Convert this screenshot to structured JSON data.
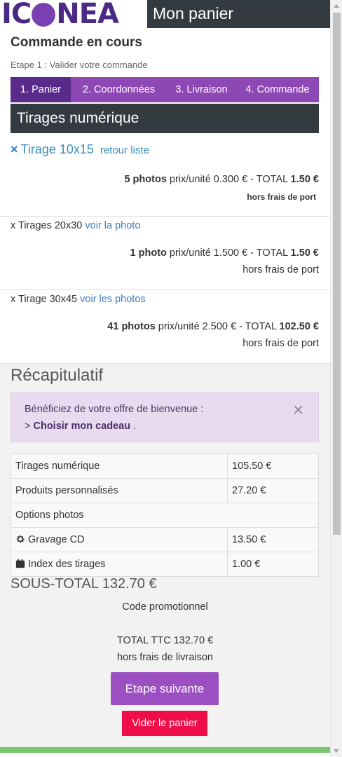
{
  "header": {
    "logo_text_left": "IC",
    "logo_text_right": "NEA",
    "title": "Mon panier"
  },
  "order": {
    "heading": "Commande en cours",
    "step_text": "Etape 1 : Valider votre commande",
    "steps": [
      "1. Panier",
      "2. Coordonnées",
      "3. Livraison",
      "4. Commande"
    ]
  },
  "section": {
    "title": "Tirages numérique"
  },
  "items": [
    {
      "close_icon": "×",
      "name": "Tirage 10x15",
      "link": "retour liste",
      "qty": "5 photos",
      "unit_label": " prix/unité 0.300 € - TOTAL ",
      "total": "1.50 €",
      "note": "hors frais de port"
    },
    {
      "prefix": "x Tirages 20x30 ",
      "link": "voir la photo",
      "qty": "1 photo",
      "unit_label": " prix/unité 1.500 € - TOTAL ",
      "total": "1.50 €",
      "note": "hors frais de port"
    },
    {
      "prefix": "x Tirage 30x45 ",
      "link": "voir les photos",
      "qty": "41 photos",
      "unit_label": " prix/unité 2.500 € - TOTAL ",
      "total": "102.50 €",
      "note": "hors frais de port"
    }
  ],
  "recap": {
    "title": "Récapitulatif",
    "alert_line1": "Bénéficiez de votre offre de bienvenue :",
    "alert_prefix": "> ",
    "alert_link": "Choisir mon cadeau",
    "alert_suffix": " .",
    "alert_close": "×",
    "rows": [
      {
        "label": "Tirages numérique",
        "value": "105.50 €"
      },
      {
        "label": "Produits personnalisés",
        "value": "27.20 €"
      },
      {
        "label": "Options photos"
      },
      {
        "icon": "gear-icon",
        "label": "Gravage CD",
        "value": "13.50 €"
      },
      {
        "icon": "calendar-icon",
        "label": "Index des tirages",
        "value": "1.00 €"
      }
    ],
    "subtotal": "SOUS-TOTAL 132.70 €",
    "promo": "Code promotionnel",
    "total_ttc": "TOTAL TTC 132.70 €",
    "total_note": "hors frais de livraison"
  },
  "buttons": {
    "next": "Etape suivante",
    "empty": "Vider le panier"
  },
  "colors": {
    "brand_purple": "#8e48b5",
    "active_step": "#5a2a8a",
    "dark_bar": "#333a40",
    "danger": "#f00e4a",
    "success_bar": "#7ac66e"
  }
}
